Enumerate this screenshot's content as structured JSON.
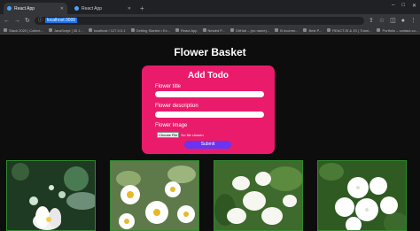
{
  "browser": {
    "tabs": [
      {
        "label": "React App",
        "active": true
      },
      {
        "label": "React App",
        "active": false
      }
    ],
    "new_tab": "+",
    "url": "localhost:3000",
    "window_controls": [
      "–",
      "□",
      "✕"
    ],
    "bookmarks": [
      "Stack 2020 | Collect...",
      "JavaScript | 30 J...",
      "localhost / 127.0.0.1",
      "Getting Started • Ex...",
      "React App",
      "Nested P...",
      "GitHub – (no name)...",
      "B ecomm...",
      "Best P...",
      "REACTJS & JS | Tutori...",
      "Portfolio – contact.co..."
    ]
  },
  "page": {
    "title": "Flower Basket",
    "form": {
      "heading": "Add Todo",
      "title_label": "Flower title",
      "description_label": "Flower description",
      "image_label": "Flower Image",
      "choose_file": "Choose File",
      "no_file": "No file chosen",
      "submit": "Submit"
    },
    "gallery_count": 4
  },
  "colors": {
    "card": "#ea1b6b",
    "submit": "#6a34f0",
    "photo_border": "#2e8b2e"
  }
}
